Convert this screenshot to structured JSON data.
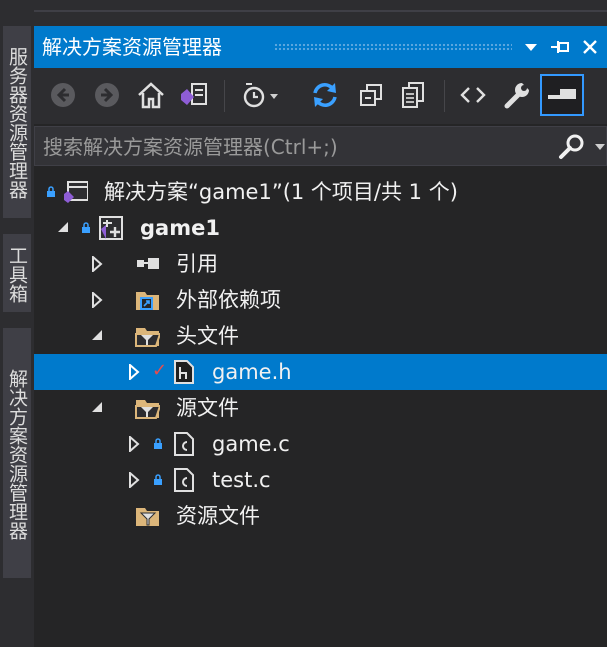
{
  "side_tabs": [
    "服务器资源管理器",
    "工具箱",
    "解决方案资源管理器"
  ],
  "panel": {
    "title": "解决方案资源管理器",
    "buttons": [
      "dropdown",
      "pin",
      "close"
    ]
  },
  "toolbar": {
    "items": [
      "back-icon",
      "forward-icon",
      "home-icon",
      "vs-solution-switch-icon",
      "pending-changes-icon",
      "sync-icon",
      "collapse-all-icon",
      "show-all-files-icon",
      "view-code-icon",
      "properties-icon",
      "preview-icon"
    ]
  },
  "search": {
    "placeholder": "搜索解决方案资源管理器(Ctrl+;)",
    "value": ""
  },
  "tree": {
    "solution": "解决方案“game1”(1 个项目/共 1 个)",
    "project": "game1",
    "references": "引用",
    "external_deps": "外部依赖项",
    "header_files": "头文件",
    "game_h": "game.h",
    "source_files": "源文件",
    "game_c": "game.c",
    "test_c": "test.c",
    "resource_files": "资源文件"
  },
  "colors": {
    "accent": "#007acc",
    "background": "#252526",
    "toolbar": "#2d2d30",
    "check": "#e84c4c"
  }
}
